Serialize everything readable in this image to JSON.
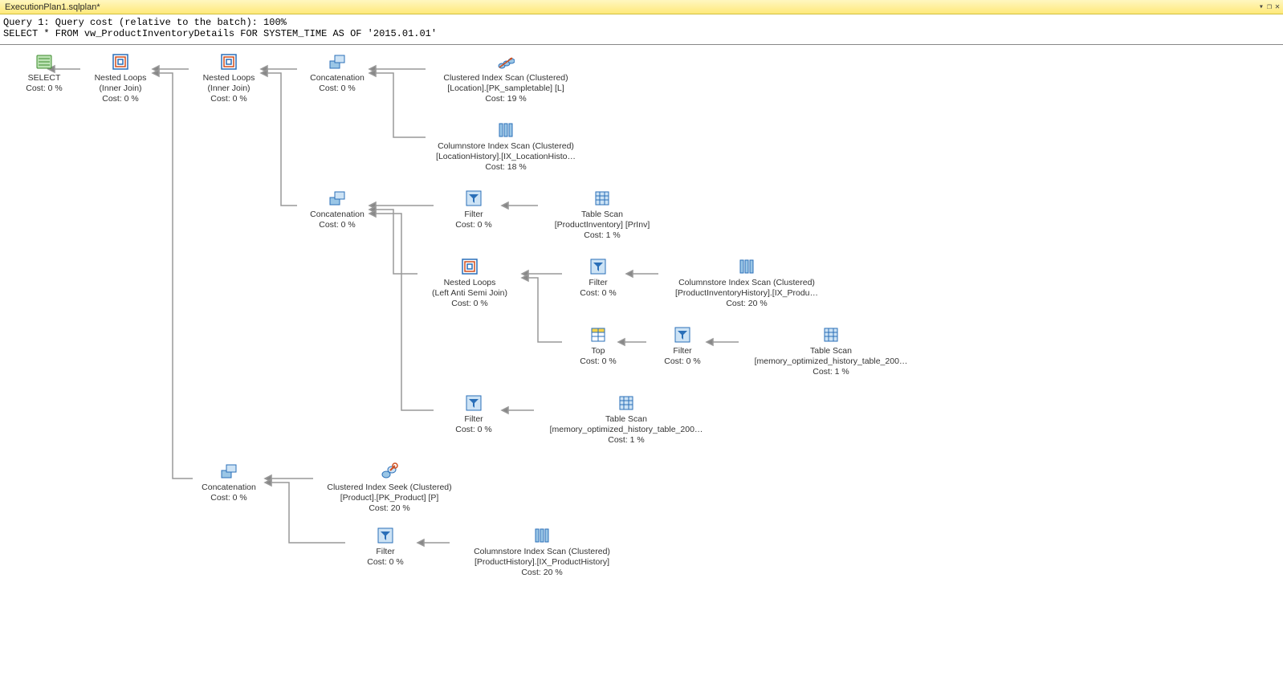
{
  "tab": {
    "title": "ExecutionPlan1.sqlplan*",
    "btn_dropdown": "▾",
    "btn_restore": "❐",
    "btn_close": "✕"
  },
  "header": {
    "line1": "Query 1: Query cost (relative to the batch): 100%",
    "line2": "SELECT * FROM vw_ProductInventoryDetails FOR SYSTEM_TIME AS OF '2015.01.01'"
  },
  "nodes": {
    "select": {
      "l1": "SELECT",
      "l2": "",
      "l3": "Cost: 0 %"
    },
    "nl1": {
      "l1": "Nested Loops",
      "l2": "(Inner Join)",
      "l3": "Cost: 0 %"
    },
    "nl2": {
      "l1": "Nested Loops",
      "l2": "(Inner Join)",
      "l3": "Cost: 0 %"
    },
    "concat1": {
      "l1": "Concatenation",
      "l2": "",
      "l3": "Cost: 0 %"
    },
    "cis1": {
      "l1": "Clustered Index Scan (Clustered)",
      "l2": "[Location].[PK_sampletable] [L]",
      "l3": "Cost: 19 %"
    },
    "colscan1": {
      "l1": "Columnstore Index Scan (Clustered)",
      "l2": "[LocationHistory].[IX_LocationHisto…",
      "l3": "Cost: 18 %"
    },
    "concat2": {
      "l1": "Concatenation",
      "l2": "",
      "l3": "Cost: 0 %"
    },
    "filter1": {
      "l1": "Filter",
      "l2": "",
      "l3": "Cost: 0 %"
    },
    "tscan1": {
      "l1": "Table Scan",
      "l2": "[ProductInventory] [PrInv]",
      "l3": "Cost: 1 %"
    },
    "nl3": {
      "l1": "Nested Loops",
      "l2": "(Left Anti Semi Join)",
      "l3": "Cost: 0 %"
    },
    "filter2": {
      "l1": "Filter",
      "l2": "",
      "l3": "Cost: 0 %"
    },
    "colscan2": {
      "l1": "Columnstore Index Scan (Clustered)",
      "l2": "[ProductInventoryHistory].[IX_Produ…",
      "l3": "Cost: 20 %"
    },
    "top": {
      "l1": "Top",
      "l2": "",
      "l3": "Cost: 0 %"
    },
    "filter3": {
      "l1": "Filter",
      "l2": "",
      "l3": "Cost: 0 %"
    },
    "tscan2": {
      "l1": "Table Scan",
      "l2": "[memory_optimized_history_table_200…",
      "l3": "Cost: 1 %"
    },
    "filter4": {
      "l1": "Filter",
      "l2": "",
      "l3": "Cost: 0 %"
    },
    "tscan3": {
      "l1": "Table Scan",
      "l2": "[memory_optimized_history_table_200…",
      "l3": "Cost: 1 %"
    },
    "concat3": {
      "l1": "Concatenation",
      "l2": "",
      "l3": "Cost: 0 %"
    },
    "ciseek": {
      "l1": "Clustered Index Seek (Clustered)",
      "l2": "[Product].[PK_Product] [P]",
      "l3": "Cost: 20 %"
    },
    "filter5": {
      "l1": "Filter",
      "l2": "",
      "l3": "Cost: 0 %"
    },
    "colscan3": {
      "l1": "Columnstore Index Scan (Clustered)",
      "l2": "[ProductHistory].[IX_ProductHistory]",
      "l3": "Cost: 20 %"
    }
  }
}
